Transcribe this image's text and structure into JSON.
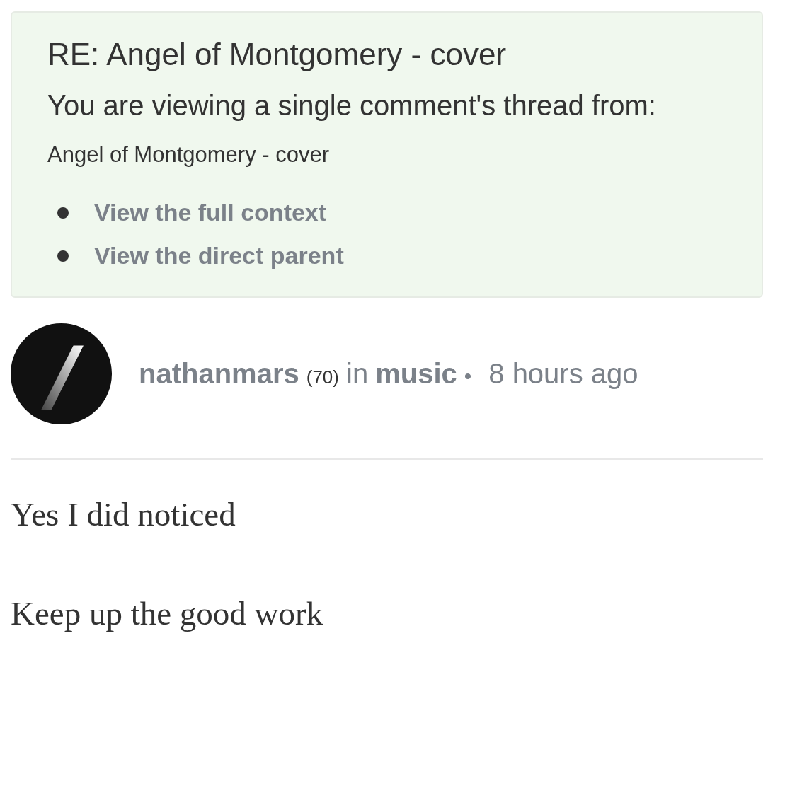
{
  "context_box": {
    "title": "RE: Angel of Montgomery - cover",
    "intro": "You are viewing a single comment's thread from:",
    "post_title": "Angel of Montgomery - cover",
    "links": [
      {
        "label": "View the full context"
      },
      {
        "label": "View the direct parent"
      }
    ]
  },
  "comment": {
    "author": "nathanmars",
    "reputation": "(70)",
    "in_word": "in",
    "community": "music",
    "separator": "•",
    "time": "8 hours ago",
    "body": [
      "Yes I did noticed",
      "Keep up the good work"
    ]
  }
}
